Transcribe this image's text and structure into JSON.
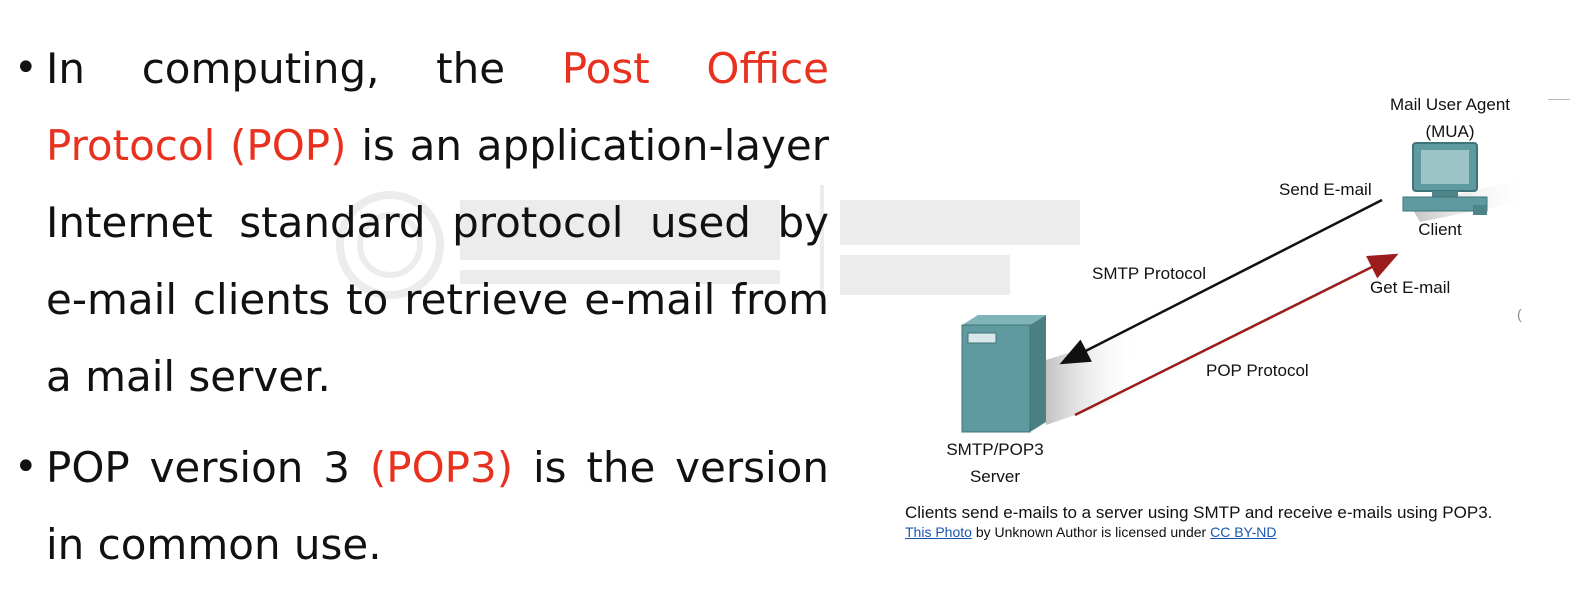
{
  "bullets": [
    {
      "parts": [
        {
          "text": "In computing, the ",
          "highlight": false
        },
        {
          "text": "Post Office Protocol (POP)",
          "highlight": true
        },
        {
          "text": " is an application-layer Internet standard protocol used by e-mail clients to retrieve e-mail from a mail server.",
          "highlight": false
        }
      ]
    },
    {
      "parts": [
        {
          "text": "POP version 3 ",
          "highlight": false
        },
        {
          "text": "(POP3)",
          "highlight": true
        },
        {
          "text": " is the version in common use.",
          "highlight": false
        }
      ]
    }
  ],
  "diagram": {
    "mua_label_line1": "Mail User Agent",
    "mua_label_line2": "(MUA)",
    "client_label": "Client",
    "send_email": "Send E-mail",
    "smtp_protocol": "SMTP Protocol",
    "get_email": "Get E-mail",
    "pop_protocol": "POP Protocol",
    "server_label_line1": "SMTP/POP3",
    "server_label_line2": "Server"
  },
  "caption": "Clients send e-mails to a server using SMTP and receive e-mails using POP3.",
  "credit": {
    "link_text": "This Photo",
    "middle_text": " by Unknown Author is licensed under ",
    "license_text": "CC BY-ND"
  },
  "colors": {
    "highlight": "#e8321f",
    "device_teal": "#5f9aa0",
    "smtp_arrow": "#111111",
    "pop_arrow": "#9b1c1c",
    "link": "#1a56b0"
  },
  "icons": [
    "computer-icon",
    "server-icon"
  ]
}
